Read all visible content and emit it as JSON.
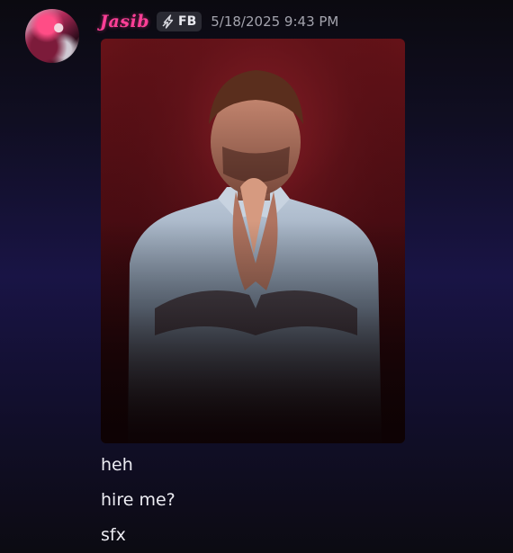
{
  "message": {
    "author": {
      "username": "Jasib",
      "tag_label": "FB",
      "tag_icon": "lightning-bolt-icon",
      "avatar": "user-avatar",
      "username_color": "#ff3f97"
    },
    "timestamp": "5/18/2025 9:43 PM",
    "attachment": {
      "type": "image",
      "subject": "portrait-praying-hands-dark-red-background"
    },
    "lines": [
      "heh",
      "hire me?",
      "sfx"
    ]
  },
  "colors": {
    "background_top": "#0b0a10",
    "background_mid": "#191445",
    "timestamp": "#a3a3ad",
    "text": "#ececf2"
  }
}
